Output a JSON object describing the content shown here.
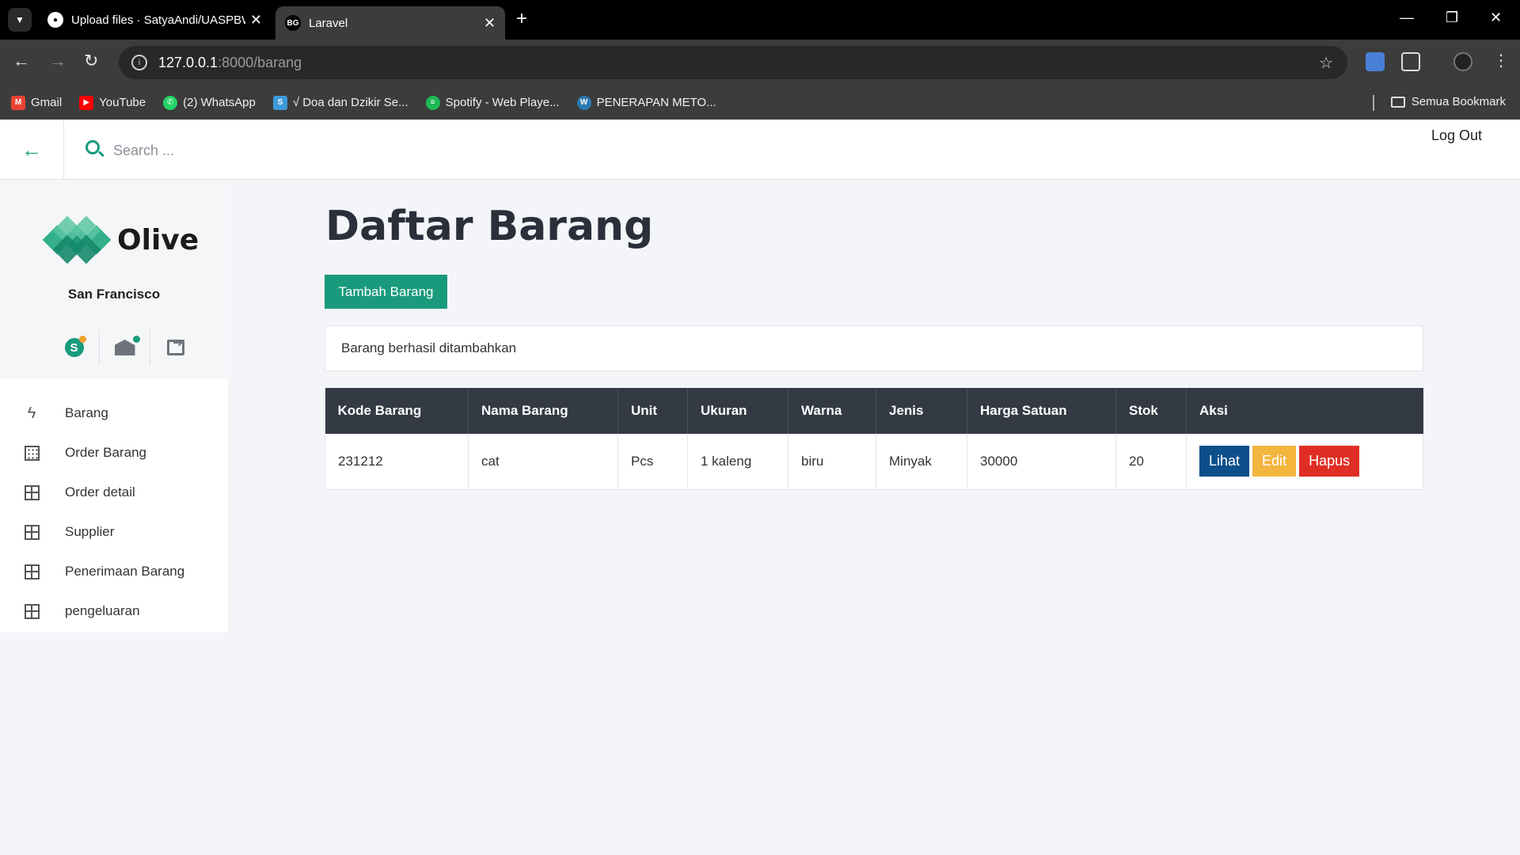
{
  "browser": {
    "tabs": [
      {
        "title": "Upload files · SatyaAndi/UASPBW",
        "favicon": "github-icon"
      },
      {
        "title": "Laravel",
        "favicon": "bg-icon",
        "favicon_text": "BG"
      }
    ],
    "url_host": "127.0.0.1",
    "url_path": ":8000/barang",
    "bookmarks": [
      {
        "label": "Gmail",
        "icon": "gmail-icon",
        "color": "#ea4335"
      },
      {
        "label": "YouTube",
        "icon": "youtube-icon",
        "color": "#ff0000"
      },
      {
        "label": "(2) WhatsApp",
        "icon": "whatsapp-icon",
        "color": "#25d366"
      },
      {
        "label": "√ Doa dan Dzikir Se...",
        "icon": "s-icon",
        "color": "#3b9ad9"
      },
      {
        "label": "Spotify - Web Playe...",
        "icon": "spotify-icon",
        "color": "#1db954"
      },
      {
        "label": "PENERAPAN METO...",
        "icon": "wordpress-icon",
        "color": "#2a7ab0"
      }
    ],
    "all_bookmarks": "Semua Bookmark"
  },
  "header": {
    "search_placeholder": "Search ...",
    "logout": "Log Out"
  },
  "sidebar": {
    "brand": "Olive",
    "city": "San Francisco",
    "accent": "#1a9a7c",
    "menu": [
      {
        "label": "Barang",
        "icon": "bolt-icon"
      },
      {
        "label": "Order Barang",
        "icon": "dots-grid-icon"
      },
      {
        "label": "Order detail",
        "icon": "grid-icon"
      },
      {
        "label": "Supplier",
        "icon": "grid-icon"
      },
      {
        "label": "Penerimaan Barang",
        "icon": "grid-icon"
      },
      {
        "label": "pengeluaran",
        "icon": "grid-icon"
      }
    ]
  },
  "main": {
    "title": "Daftar Barang",
    "add_button": "Tambah Barang",
    "alert": "Barang berhasil ditambahkan",
    "table": {
      "headers": [
        "Kode Barang",
        "Nama Barang",
        "Unit",
        "Ukuran",
        "Warna",
        "Jenis",
        "Harga Satuan",
        "Stok",
        "Aksi"
      ],
      "rows": [
        [
          "231212",
          "cat",
          "Pcs",
          "1 kaleng",
          "biru",
          "Minyak",
          "30000",
          "20"
        ]
      ],
      "actions": {
        "view": "Lihat",
        "edit": "Edit",
        "delete": "Hapus"
      }
    }
  }
}
